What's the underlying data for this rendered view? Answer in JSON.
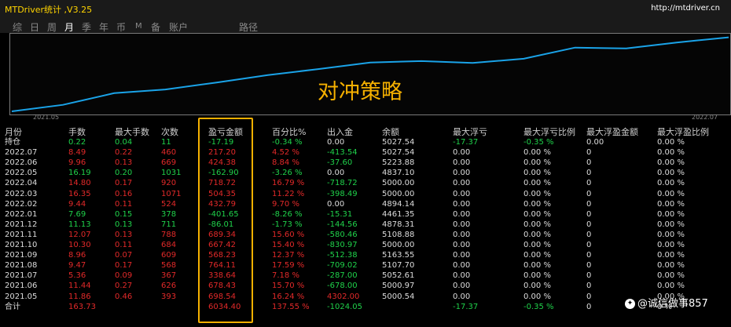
{
  "window": {
    "title": "MTDriver统计 ,V3.25",
    "url": "http://mtdriver.cn"
  },
  "tabs": [
    {
      "label": "综",
      "active": false
    },
    {
      "label": "日",
      "active": false
    },
    {
      "label": "周",
      "active": false
    },
    {
      "label": "月",
      "active": true
    },
    {
      "label": "季",
      "active": false
    },
    {
      "label": "年",
      "active": false
    },
    {
      "label": "币",
      "active": false
    },
    {
      "label": "M",
      "active": false
    },
    {
      "label": "备",
      "active": false
    },
    {
      "label": "账户",
      "active": false
    },
    {
      "label": "路径",
      "active": false
    }
  ],
  "overlay_text": "对冲策略",
  "chart_data": {
    "type": "line",
    "x": [
      "2021.05",
      "2021.06",
      "2021.07",
      "2021.08",
      "2021.09",
      "2021.10",
      "2021.11",
      "2021.12",
      "2022.01",
      "2022.02",
      "2022.03",
      "2022.04",
      "2022.05",
      "2022.06",
      "2022.07"
    ],
    "x_tick_labels": [
      "2021.05",
      "2022.07"
    ],
    "series": [
      {
        "values": [
          5000,
          5140,
          5390,
          5470,
          5620,
          5780,
          5910,
          6050,
          6080,
          6040,
          6130,
          6370,
          6350,
          6480,
          6590
        ]
      }
    ],
    "color": "#1aa3e8",
    "grid": false
  },
  "table": {
    "headers": [
      "月份",
      "手数",
      "最大手数",
      "次数",
      "盈亏金额",
      "百分比%",
      "出入金",
      "余额",
      "最大浮亏",
      "最大浮亏比例",
      "最大浮盈金额",
      "最大浮盈比例"
    ],
    "rows": [
      {
        "cells": [
          "持仓",
          "0.22",
          "0.04",
          "11",
          "-17.19",
          "-0.34 %",
          "0.00",
          "5027.54",
          "-17.37",
          "-0.35 %",
          "0.00",
          "0.00 %"
        ],
        "colors": [
          "white",
          "green",
          "green",
          "green",
          "green",
          "green",
          "white",
          "white",
          "green",
          "green",
          "white",
          "white"
        ]
      },
      {
        "cells": [
          "2022.07",
          "8.49",
          "0.22",
          "460",
          "217.20",
          "4.52 %",
          "-413.54",
          "5027.54",
          "0.00",
          "0.00 %",
          "0",
          "0.00 %"
        ],
        "colors": [
          "white",
          "red",
          "red",
          "red",
          "red",
          "red",
          "green",
          "white",
          "white",
          "white",
          "white",
          "white"
        ]
      },
      {
        "cells": [
          "2022.06",
          "9.96",
          "0.13",
          "669",
          "424.38",
          "8.84 %",
          "-37.60",
          "5223.88",
          "0.00",
          "0.00 %",
          "0",
          "0.00 %"
        ],
        "colors": [
          "white",
          "red",
          "red",
          "red",
          "red",
          "red",
          "green",
          "white",
          "white",
          "white",
          "white",
          "white"
        ]
      },
      {
        "cells": [
          "2022.05",
          "16.19",
          "0.20",
          "1031",
          "-162.90",
          "-3.26 %",
          "0.00",
          "4837.10",
          "0.00",
          "0.00 %",
          "0",
          "0.00 %"
        ],
        "colors": [
          "white",
          "green",
          "green",
          "green",
          "green",
          "green",
          "white",
          "white",
          "white",
          "white",
          "white",
          "white"
        ]
      },
      {
        "cells": [
          "2022.04",
          "14.80",
          "0.17",
          "920",
          "718.72",
          "16.79 %",
          "-718.72",
          "5000.00",
          "0.00",
          "0.00 %",
          "0",
          "0.00 %"
        ],
        "colors": [
          "white",
          "red",
          "red",
          "red",
          "red",
          "red",
          "green",
          "white",
          "white",
          "white",
          "white",
          "white"
        ]
      },
      {
        "cells": [
          "2022.03",
          "16.35",
          "0.16",
          "1071",
          "504.35",
          "11.22 %",
          "-398.49",
          "5000.00",
          "0.00",
          "0.00 %",
          "0",
          "0.00 %"
        ],
        "colors": [
          "white",
          "red",
          "red",
          "red",
          "red",
          "red",
          "green",
          "white",
          "white",
          "white",
          "white",
          "white"
        ]
      },
      {
        "cells": [
          "2022.02",
          "9.44",
          "0.11",
          "524",
          "432.79",
          "9.70 %",
          "0.00",
          "4894.14",
          "0.00",
          "0.00 %",
          "0",
          "0.00 %"
        ],
        "colors": [
          "white",
          "red",
          "red",
          "red",
          "red",
          "red",
          "white",
          "white",
          "white",
          "white",
          "white",
          "white"
        ]
      },
      {
        "cells": [
          "2022.01",
          "7.69",
          "0.15",
          "378",
          "-401.65",
          "-8.26 %",
          "-15.31",
          "4461.35",
          "0.00",
          "0.00 %",
          "0",
          "0.00 %"
        ],
        "colors": [
          "white",
          "green",
          "green",
          "green",
          "green",
          "green",
          "green",
          "white",
          "white",
          "white",
          "white",
          "white"
        ]
      },
      {
        "cells": [
          "2021.12",
          "11.13",
          "0.13",
          "711",
          "-86.01",
          "-1.73 %",
          "-144.56",
          "4878.31",
          "0.00",
          "0.00 %",
          "0",
          "0.00 %"
        ],
        "colors": [
          "white",
          "green",
          "green",
          "green",
          "green",
          "green",
          "green",
          "white",
          "white",
          "white",
          "white",
          "white"
        ]
      },
      {
        "cells": [
          "2021.11",
          "12.07",
          "0.13",
          "788",
          "689.34",
          "15.60 %",
          "-580.46",
          "5108.88",
          "0.00",
          "0.00 %",
          "0",
          "0.00 %"
        ],
        "colors": [
          "white",
          "red",
          "red",
          "red",
          "red",
          "red",
          "green",
          "white",
          "white",
          "white",
          "white",
          "white"
        ]
      },
      {
        "cells": [
          "2021.10",
          "10.30",
          "0.11",
          "684",
          "667.42",
          "15.40 %",
          "-830.97",
          "5000.00",
          "0.00",
          "0.00 %",
          "0",
          "0.00 %"
        ],
        "colors": [
          "white",
          "red",
          "red",
          "red",
          "red",
          "red",
          "green",
          "white",
          "white",
          "white",
          "white",
          "white"
        ]
      },
      {
        "cells": [
          "2021.09",
          "8.96",
          "0.07",
          "609",
          "568.23",
          "12.37 %",
          "-512.38",
          "5163.55",
          "0.00",
          "0.00 %",
          "0",
          "0.00 %"
        ],
        "colors": [
          "white",
          "red",
          "red",
          "red",
          "red",
          "red",
          "green",
          "white",
          "white",
          "white",
          "white",
          "white"
        ]
      },
      {
        "cells": [
          "2021.08",
          "9.47",
          "0.17",
          "568",
          "764.11",
          "17.59 %",
          "-709.02",
          "5107.70",
          "0.00",
          "0.00 %",
          "0",
          "0.00 %"
        ],
        "colors": [
          "white",
          "red",
          "red",
          "red",
          "red",
          "red",
          "green",
          "white",
          "white",
          "white",
          "white",
          "white"
        ]
      },
      {
        "cells": [
          "2021.07",
          "5.36",
          "0.09",
          "367",
          "338.64",
          "7.18 %",
          "-287.00",
          "5052.61",
          "0.00",
          "0.00 %",
          "0",
          "0.00 %"
        ],
        "colors": [
          "white",
          "red",
          "red",
          "red",
          "red",
          "red",
          "green",
          "white",
          "white",
          "white",
          "white",
          "white"
        ]
      },
      {
        "cells": [
          "2021.06",
          "11.44",
          "0.27",
          "626",
          "678.43",
          "15.70 %",
          "-678.00",
          "5000.97",
          "0.00",
          "0.00 %",
          "0",
          "0.00 %"
        ],
        "colors": [
          "white",
          "red",
          "red",
          "red",
          "red",
          "red",
          "green",
          "white",
          "white",
          "white",
          "white",
          "white"
        ]
      },
      {
        "cells": [
          "2021.05",
          "11.86",
          "0.46",
          "393",
          "698.54",
          "16.24 %",
          "4302.00",
          "5000.54",
          "0.00",
          "0.00 %",
          "0",
          "0.00 %"
        ],
        "colors": [
          "white",
          "red",
          "red",
          "red",
          "red",
          "red",
          "red",
          "white",
          "white",
          "white",
          "white",
          "white"
        ]
      },
      {
        "cells": [
          "合计",
          "163.73",
          "",
          "",
          "6034.40",
          "137.55 %",
          "-1024.05",
          "",
          "-17.37",
          "-0.35 %",
          "0",
          "0 %"
        ],
        "colors": [
          "white",
          "red",
          "red",
          "red",
          "red",
          "red",
          "green",
          "white",
          "green",
          "green",
          "white",
          "white"
        ]
      }
    ]
  },
  "watermark": "@诚信做事857",
  "colors": {
    "title": "#ffd400",
    "accent": "#f5b000",
    "line": "#1aa3e8",
    "profit": "#e22929",
    "loss": "#1fd14a"
  }
}
